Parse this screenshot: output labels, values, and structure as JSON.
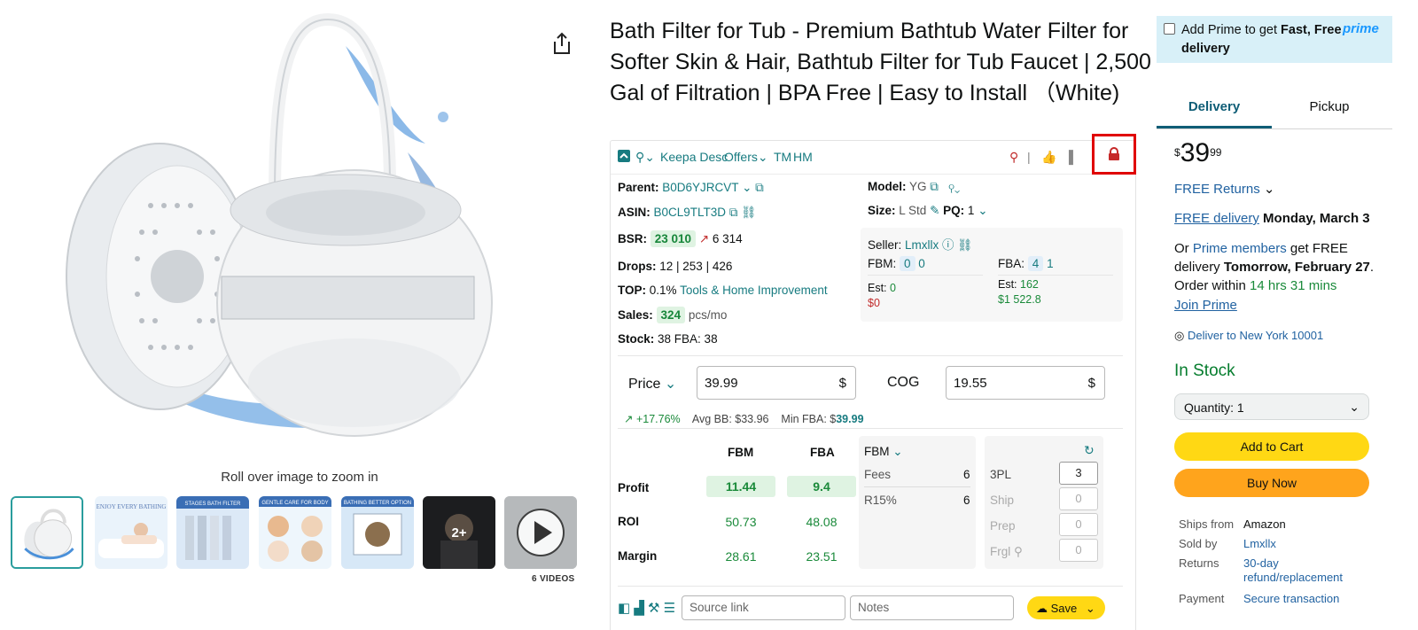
{
  "product": {
    "title": "Bath Filter for Tub - Premium Bathtub Water Filter for Softer Skin & Hair, Bathtub Filter for Tub Faucet | 2,500 Gal of Filtration | BPA Free | Easy to Install （White)",
    "zoom_hint": "Roll over image to zoom in",
    "thumbnails": [
      {
        "label": ""
      },
      {
        "label": "ENJOY EVERY BATHING"
      },
      {
        "label": "STAGES BATH FILTER"
      },
      {
        "label": "GENTLE CARE FOR BODY"
      },
      {
        "label": "BATHING BETTER OPTION"
      },
      {
        "label": "2+"
      },
      {
        "label": ""
      }
    ],
    "videos_label": "6 VIDEOS"
  },
  "keepa": {
    "toolbar": {
      "desc": "Keepa Desc",
      "offers": "Offers",
      "tm": "TM",
      "hm": "HM"
    },
    "parent_label": "Parent:",
    "parent_value": "B0D6YJRCVT",
    "asin_label": "ASIN:",
    "asin_value": "B0CL9TLT3D",
    "bsr_label": "BSR:",
    "bsr_value": "23 010",
    "bsr_trend": "6 314",
    "drops_label": "Drops:",
    "drops_value": "12 | 253 | 426",
    "top_label": "TOP:",
    "top_pct": "0.1%",
    "top_category": "Tools & Home Improvement",
    "sales_label": "Sales:",
    "sales_value": "324",
    "sales_unit": "pcs/mo",
    "stock_label": "Stock:",
    "stock_value": "38 FBA: 38",
    "model_label": "Model:",
    "model_value": "YG",
    "size_label": "Size:",
    "size_value": "L Std",
    "pq_label": "PQ:",
    "pq_value": "1",
    "seller_label": "Seller:",
    "seller_value": "Lmxllx",
    "fbm_label": "FBM:",
    "fbm_a": "0",
    "fbm_b": "0",
    "fba_label": "FBA:",
    "fba_a": "4",
    "fba_b": "1",
    "est_label": "Est:",
    "fbm_est": "0",
    "fbm_est_money": "$0",
    "fba_est": "162",
    "fba_est_money": "$1 522.8",
    "price_label": "Price",
    "price_value": "39.99",
    "currency": "$",
    "cog_label": "COG",
    "cog_value": "19.55",
    "trend_pct": "+17.76%",
    "avg_bb": "Avg BB: $33.96",
    "min_fba_label": "Min FBA: $",
    "min_fba_value": "39.99",
    "grid": {
      "col_fbm": "FBM",
      "col_fba": "FBA",
      "rows": [
        {
          "label": "Profit",
          "fbm": "11.44",
          "fba": "9.4"
        },
        {
          "label": "ROI",
          "fbm": "50.73",
          "fba": "48.08"
        },
        {
          "label": "Margin",
          "fbm": "28.61",
          "fba": "23.51"
        }
      ]
    },
    "fees_panel": {
      "mode": "FBM",
      "fees_label": "Fees",
      "fees_value": "6",
      "r15_label": "R15%",
      "r15_value": "6"
    },
    "extra_panel": {
      "threepl_label": "3PL",
      "threepl_value": "3",
      "ship_label": "Ship",
      "ship_value": "0",
      "prep_label": "Prep",
      "prep_value": "0",
      "frgl_label": "Frgl",
      "frgl_value": "0"
    },
    "source_placeholder": "Source link",
    "notes_placeholder": "Notes",
    "save_label": "Save"
  },
  "buybox": {
    "prime_text_1": "Add Prime to get ",
    "prime_text_bold": "Fast, Free delivery",
    "prime_logo": "prime",
    "tab_delivery": "Delivery",
    "tab_pickup": "Pickup",
    "price_sym": "$",
    "price_whole": "39",
    "price_fraction": "99",
    "free_returns": "FREE Returns",
    "free_delivery": "FREE delivery",
    "delivery_date": "Monday, March 3",
    "or": "Or ",
    "prime_members": "Prime members",
    "get_free": " get FREE delivery ",
    "tomorrow": "Tomorrow, February 27",
    "order_within": ". Order within ",
    "countdown": "14 hrs 31 mins",
    "join_prime": "Join Prime",
    "deliver_to": "Deliver to New York 10001",
    "in_stock": "In Stock",
    "quantity": "Quantity:  1",
    "add_to_cart": "Add to Cart",
    "buy_now": "Buy Now",
    "ships_from_label": "Ships from",
    "ships_from_value": "Amazon",
    "sold_by_label": "Sold by",
    "sold_by_value": "Lmxllx",
    "returns_label": "Returns",
    "returns_value_1": "30-day",
    "returns_value_2": "refund/replacement",
    "payment_label": "Payment",
    "payment_value": "Secure transaction"
  }
}
